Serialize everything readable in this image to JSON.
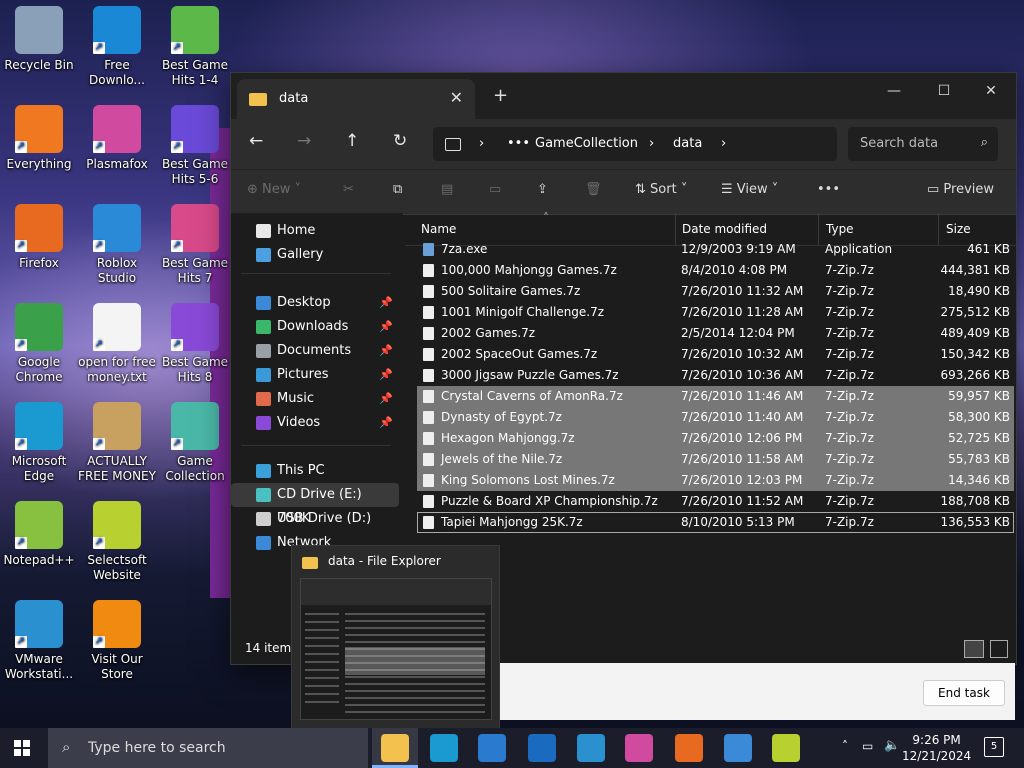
{
  "desktop": {
    "icons": [
      {
        "label": "Recycle Bin",
        "icon": "recycle-bin-icon",
        "color": "#8aa0b8"
      },
      {
        "label": "Free Downlo...",
        "icon": "download-icon",
        "color": "#1a88d4"
      },
      {
        "label": "Best Game Hits 1-4",
        "icon": "dice-icon",
        "color": "#5db84a"
      },
      {
        "label": "Everything",
        "icon": "magnifier-icon",
        "color": "#f07820"
      },
      {
        "label": "Plasmafox",
        "icon": "plasmafox-icon",
        "color": "#d04aa0"
      },
      {
        "label": "Best Game Hits 5-6",
        "icon": "dice-icon",
        "color": "#6a4ad8"
      },
      {
        "label": "Firefox",
        "icon": "firefox-icon",
        "color": "#e86a20"
      },
      {
        "label": "Roblox Studio",
        "icon": "roblox-icon",
        "color": "#2a8ad8"
      },
      {
        "label": "Best Game Hits 7",
        "icon": "dice-icon",
        "color": "#d84a8a"
      },
      {
        "label": "Google Chrome",
        "icon": "chrome-icon",
        "color": "#3aa04a"
      },
      {
        "label": "open for free money.txt",
        "icon": "text-file-icon",
        "color": "#f4f4f4"
      },
      {
        "label": "Best Game Hits 8",
        "icon": "dice-icon",
        "color": "#8a4ad8"
      },
      {
        "label": "Microsoft Edge",
        "icon": "edge-icon",
        "color": "#1a9ad0"
      },
      {
        "label": "ACTUALLY FREE MONEY",
        "icon": "money-bag-icon",
        "color": "#c8a060"
      },
      {
        "label": "Game Collection",
        "icon": "dice-icon",
        "color": "#4ab8a8"
      },
      {
        "label": "Notepad++",
        "icon": "notepad-plus-icon",
        "color": "#88c040"
      },
      {
        "label": "Selectsoft Website",
        "icon": "selectsoft-icon",
        "color": "#b8d030"
      },
      {
        "label": "VMware Workstati...",
        "icon": "vmware-icon",
        "color": "#2a90d0"
      },
      {
        "label": "Visit Our Store",
        "icon": "store-icon",
        "color": "#f08a10"
      }
    ]
  },
  "explorer": {
    "tab_title": "data",
    "breadcrumb": [
      "GameCollection",
      "data"
    ],
    "search_placeholder": "Search data",
    "toolbar": {
      "new": "New",
      "sort": "Sort",
      "view": "View",
      "more": "•••",
      "preview": "Preview"
    },
    "sidebar": [
      {
        "label": "Home",
        "icon": "home-icon",
        "color": "#e8e8e8"
      },
      {
        "label": "Gallery",
        "icon": "gallery-icon",
        "color": "#4aa0e0"
      },
      {
        "label": "Desktop",
        "icon": "desktop-icon",
        "color": "#3a8ad8",
        "pinned": true
      },
      {
        "label": "Downloads",
        "icon": "downloads-icon",
        "color": "#3ab86a",
        "pinned": true
      },
      {
        "label": "Documents",
        "icon": "documents-icon",
        "color": "#9aa0a8",
        "pinned": true
      },
      {
        "label": "Pictures",
        "icon": "pictures-icon",
        "color": "#3a9ad8",
        "pinned": true
      },
      {
        "label": "Music",
        "icon": "music-icon",
        "color": "#e06a4a",
        "pinned": true
      },
      {
        "label": "Videos",
        "icon": "videos-icon",
        "color": "#8a4ad8",
        "pinned": true
      },
      {
        "label": "This PC",
        "icon": "this-pc-icon",
        "color": "#3aa0d8"
      },
      {
        "label": "CD Drive (E:) 700K",
        "icon": "cd-drive-icon",
        "color": "#4ac0c0",
        "selected": true
      },
      {
        "label": "USB Drive (D:)",
        "icon": "usb-drive-icon",
        "color": "#cfcfcf"
      },
      {
        "label": "Network",
        "icon": "network-icon",
        "color": "#3a8ad8"
      }
    ],
    "columns": [
      "Name",
      "Date modified",
      "Type",
      "Size"
    ],
    "files": [
      {
        "name": "7za.exe",
        "date": "12/9/2003 9:19 AM",
        "type": "Application",
        "size": "461 KB",
        "selected": false
      },
      {
        "name": "100,000 Mahjongg Games.7z",
        "date": "8/4/2010 4:08 PM",
        "type": "7-Zip.7z",
        "size": "444,381 KB",
        "selected": false
      },
      {
        "name": "500 Solitaire Games.7z",
        "date": "7/26/2010 11:32 AM",
        "type": "7-Zip.7z",
        "size": "18,490 KB",
        "selected": false
      },
      {
        "name": "1001 Minigolf Challenge.7z",
        "date": "7/26/2010 11:28 AM",
        "type": "7-Zip.7z",
        "size": "275,512 KB",
        "selected": false
      },
      {
        "name": "2002 Games.7z",
        "date": "2/5/2014 12:04 PM",
        "type": "7-Zip.7z",
        "size": "489,409 KB",
        "selected": false
      },
      {
        "name": "2002 SpaceOut Games.7z",
        "date": "7/26/2010 10:32 AM",
        "type": "7-Zip.7z",
        "size": "150,342 KB",
        "selected": false
      },
      {
        "name": "3000 Jigsaw Puzzle Games.7z",
        "date": "7/26/2010 10:36 AM",
        "type": "7-Zip.7z",
        "size": "693,266 KB",
        "selected": false
      },
      {
        "name": "Crystal Caverns of AmonRa.7z",
        "date": "7/26/2010 11:46 AM",
        "type": "7-Zip.7z",
        "size": "59,957 KB",
        "selected": true
      },
      {
        "name": "Dynasty of Egypt.7z",
        "date": "7/26/2010 11:40 AM",
        "type": "7-Zip.7z",
        "size": "58,300 KB",
        "selected": true
      },
      {
        "name": "Hexagon Mahjongg.7z",
        "date": "7/26/2010 12:06 PM",
        "type": "7-Zip.7z",
        "size": "52,725 KB",
        "selected": true
      },
      {
        "name": "Jewels of the Nile.7z",
        "date": "7/26/2010 11:58 AM",
        "type": "7-Zip.7z",
        "size": "55,783 KB",
        "selected": true
      },
      {
        "name": "King Solomons Lost Mines.7z",
        "date": "7/26/2010 12:03 PM",
        "type": "7-Zip.7z",
        "size": "14,346 KB",
        "selected": true
      },
      {
        "name": "Puzzle & Board XP Championship.7z",
        "date": "7/26/2010 11:52 AM",
        "type": "7-Zip.7z",
        "size": "188,708 KB",
        "selected": false
      },
      {
        "name": "Tapiei Mahjongg 25K.7z",
        "date": "8/10/2010 5:13 PM",
        "type": "7-Zip.7z",
        "size": "136,553 KB",
        "selected": false
      }
    ],
    "status": "14 items"
  },
  "thumbnail": {
    "title": "data - File Explorer"
  },
  "task_manager": {
    "end_task": "End task"
  },
  "taskbar": {
    "search_placeholder": "Type here to search",
    "time": "9:26 PM",
    "date": "12/21/2024",
    "notification_count": "5",
    "apps": [
      {
        "icon": "file-explorer-icon",
        "color": "#f2c14e"
      },
      {
        "icon": "edge-icon",
        "color": "#1a9ad0"
      },
      {
        "icon": "store-icon",
        "color": "#2a7ad0"
      },
      {
        "icon": "outlook-icon",
        "color": "#1a6ac0"
      },
      {
        "icon": "vmware-icon",
        "color": "#2a90d0"
      },
      {
        "icon": "plasmafox-icon",
        "color": "#d04aa0"
      },
      {
        "icon": "firefox-icon",
        "color": "#e86a20"
      },
      {
        "icon": "app-icon",
        "color": "#3a8ad8"
      },
      {
        "icon": "selectsoft-icon",
        "color": "#b8d030"
      }
    ]
  }
}
